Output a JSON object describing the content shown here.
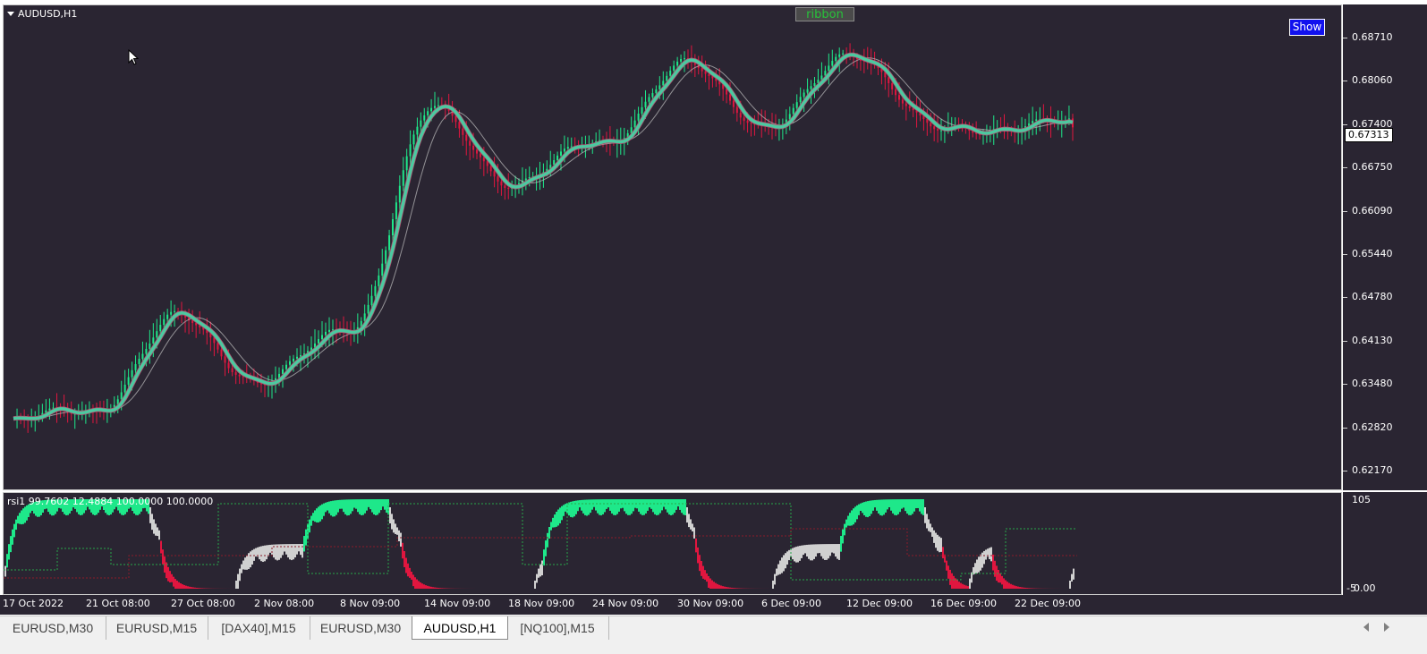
{
  "chart": {
    "symbol_title": "AUDUSD,H1",
    "ribbon_label": "ribbon",
    "show_label": "Show",
    "current_price": "0.67313",
    "price_labels": [
      "0.68710",
      "0.68060",
      "0.67400",
      "0.66750",
      "0.66090",
      "0.65440",
      "0.64780",
      "0.64130",
      "0.63480",
      "0.62820",
      "0.62170"
    ],
    "rsi_title": "rsi1 99.7602 12.4884 100.0000 100.0000",
    "rsi_scale_top": "105",
    "rsi_scale_bottom": "-5",
    "rsi_scale_bottom2": "0.00",
    "time_labels": [
      "17 Oct 2022",
      "21 Oct 08:00",
      "27 Oct 08:00",
      "2 Nov 08:00",
      "8 Nov 09:00",
      "14 Nov 09:00",
      "18 Nov 09:00",
      "24 Nov 09:00",
      "30 Nov 09:00",
      "6 Dec 09:00",
      "12 Dec 09:00",
      "16 Dec 09:00",
      "22 Dec 09:00"
    ],
    "colors": {
      "background": "#2a2532",
      "bull": "#1ee88a",
      "bear": "#e0163f",
      "ma_fast": "#4cc9a0",
      "ma_slow": "#c0c0c0",
      "ribbon_text": "#27c33a",
      "show_bg": "#1111ee"
    }
  },
  "chart_data": {
    "type": "line",
    "title": "AUDUSD,H1",
    "ylim": [
      0.6185,
      0.6915
    ],
    "x": [
      "17 Oct 2022",
      "21 Oct 08:00",
      "27 Oct 08:00",
      "2 Nov 08:00",
      "8 Nov 09:00",
      "14 Nov 09:00",
      "18 Nov 09:00",
      "24 Nov 09:00",
      "30 Nov 09:00",
      "6 Dec 09:00",
      "12 Dec 09:00",
      "16 Dec 09:00",
      "22 Dec 09:00"
    ],
    "series": [
      {
        "values": [
          0.6282,
          0.6312,
          0.6442,
          0.6345,
          0.6435,
          0.6755,
          0.6645,
          0.6715,
          0.682,
          0.6735,
          0.6845,
          0.672,
          0.674
        ]
      }
    ]
  },
  "tabs": [
    {
      "label": "EURUSD,M30",
      "active": false
    },
    {
      "label": "EURUSD,M15",
      "active": false
    },
    {
      "label": "[DAX40],M15",
      "active": false
    },
    {
      "label": "EURUSD,M30",
      "active": false
    },
    {
      "label": "AUDUSD,H1",
      "active": true
    },
    {
      "label": "[NQ100],M15",
      "active": false
    }
  ]
}
